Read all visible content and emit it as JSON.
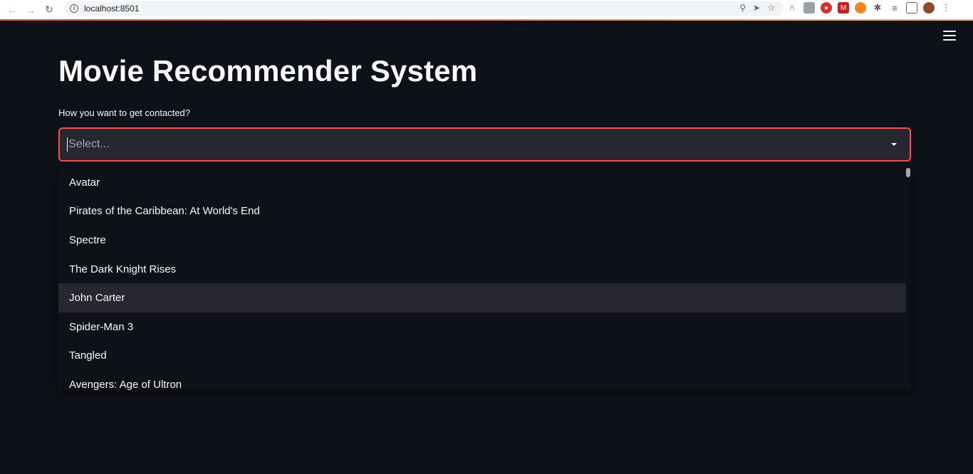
{
  "browser": {
    "url": "localhost:8501"
  },
  "app": {
    "title": "Movie Recommender System",
    "select_label": "How you want to get contacted?",
    "select_placeholder": "Select...",
    "options": [
      "Avatar",
      "Pirates of the Caribbean: At World's End",
      "Spectre",
      "The Dark Knight Rises",
      "John Carter",
      "Spider-Man 3",
      "Tangled",
      "Avengers: Age of Ultron"
    ],
    "highlighted_option": "John Carter"
  },
  "colors": {
    "background": "#0e1117",
    "accent": "#ff4b4b",
    "input_bg": "#262730",
    "text": "#fafafa"
  }
}
